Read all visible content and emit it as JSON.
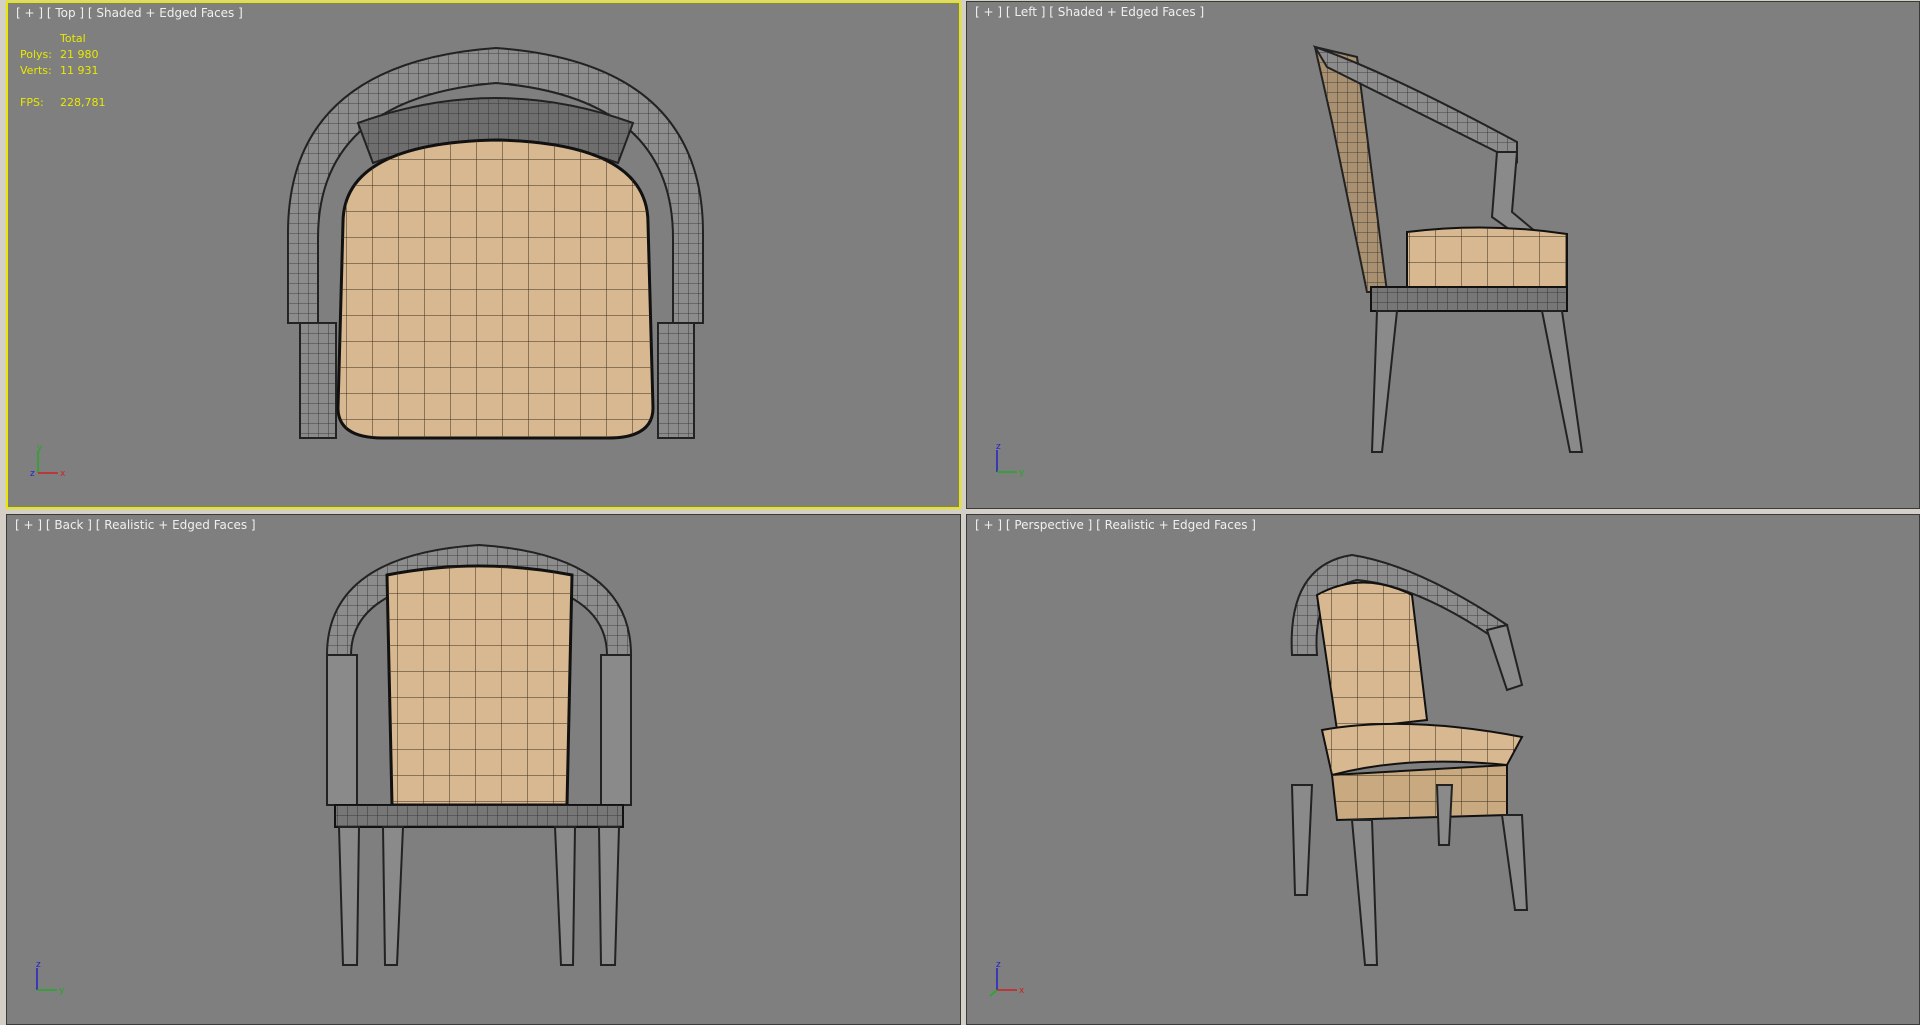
{
  "viewports": {
    "top": {
      "label": "[ + ] [ Top ] [ Shaded + Edged Faces ]"
    },
    "left": {
      "label": "[ + ] [ Left ] [ Shaded + Edged Faces ]"
    },
    "back": {
      "label": "[ + ] [ Back ] [ Realistic + Edged Faces ]"
    },
    "perspective": {
      "label": "[ + ] [ Perspective ] [ Realistic + Edged Faces ]"
    }
  },
  "stats": {
    "header": "Total",
    "polys_label": "Polys:",
    "polys_value": "21 980",
    "verts_label": "Verts:",
    "verts_value": "11 931",
    "fps_label": "FPS:",
    "fps_value": "228,781"
  },
  "axes": {
    "x": "x",
    "y": "y",
    "z": "z"
  },
  "colors": {
    "viewport_bg": "#7f7f7f",
    "active_border": "#e8e800",
    "fabric": "#d8b890",
    "frame": "#8a8a8a"
  }
}
